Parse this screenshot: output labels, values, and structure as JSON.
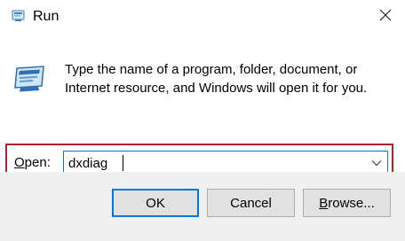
{
  "window": {
    "title": "Run",
    "app_icon": "run-icon",
    "close_icon": "close-icon"
  },
  "content": {
    "icon": "run-program-icon",
    "description_line1": "Type the name of a program, folder, document, or",
    "description_line2": "Internet resource, and Windows will open it for you."
  },
  "open_field": {
    "label_mnemonic": "O",
    "label_rest": "pen:",
    "value": "dxdiag",
    "dropdown_icon": "chevron-down-icon",
    "highlight_color": "#b3212d",
    "focus_color": "#0078d7"
  },
  "buttons": {
    "ok": "OK",
    "cancel": "Cancel",
    "browse_mnemonic": "B",
    "browse_rest": "rowse..."
  }
}
